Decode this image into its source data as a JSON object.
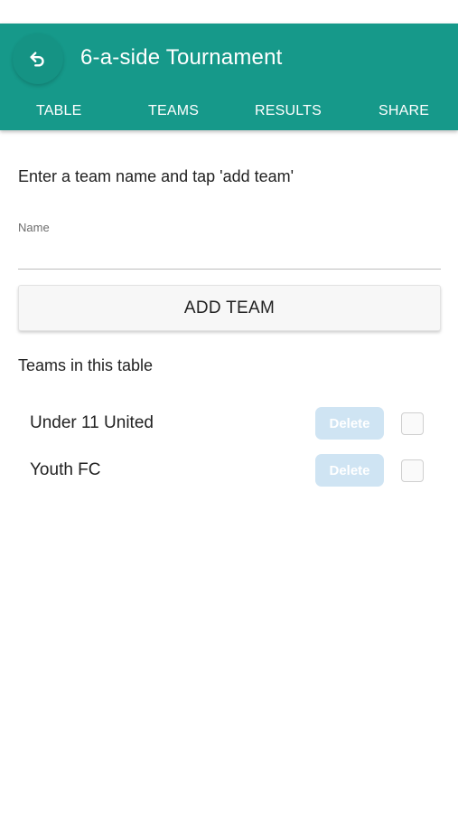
{
  "header": {
    "title": "6-a-side Tournament",
    "back_icon": "back-arrow-icon",
    "background_color": "#16998a"
  },
  "tabs": [
    {
      "label": "TABLE"
    },
    {
      "label": "TEAMS"
    },
    {
      "label": "RESULTS"
    },
    {
      "label": "SHARE"
    }
  ],
  "form": {
    "instruction": "Enter a team name and tap 'add team'",
    "name_label": "Name",
    "name_value": "",
    "add_button_label": "ADD TEAM"
  },
  "teams_section": {
    "title": "Teams in this table",
    "teams": [
      {
        "name": "Under 11 United",
        "delete_label": "Delete",
        "checked": false
      },
      {
        "name": "Youth FC",
        "delete_label": "Delete",
        "checked": false
      }
    ],
    "delete_color": "#cfe4f3"
  }
}
